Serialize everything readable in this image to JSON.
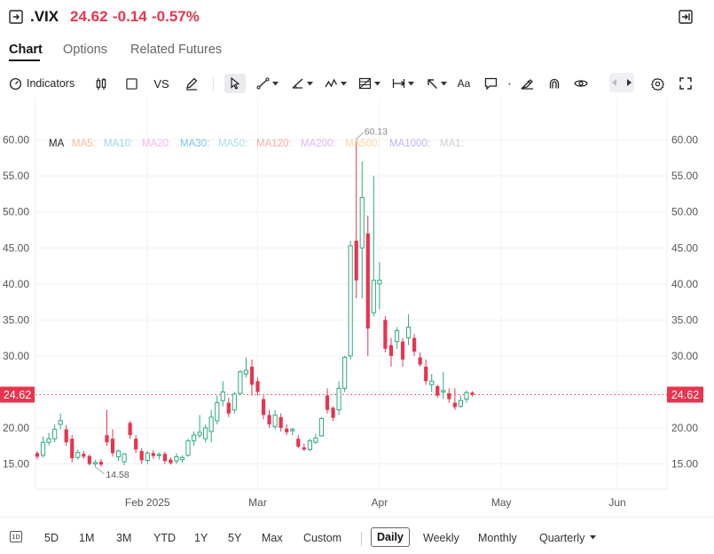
{
  "header": {
    "ticker": ".VIX",
    "price": "24.62",
    "change": "-0.14",
    "change_pct": "-0.57%"
  },
  "tabs": [
    {
      "label": "Chart",
      "active": true
    },
    {
      "label": "Options",
      "active": false
    },
    {
      "label": "Related Futures",
      "active": false
    }
  ],
  "toolbar": {
    "indicators_label": "Indicators",
    "vs_label": "VS",
    "text_label": "Aa"
  },
  "ma_legend": {
    "title": "MA",
    "items": [
      {
        "label": "MA5:",
        "color": "#f7b89a"
      },
      {
        "label": "MA10:",
        "color": "#9fd3ee"
      },
      {
        "label": "MA20:",
        "color": "#f3b6e8"
      },
      {
        "label": "MA30:",
        "color": "#7cc3e8"
      },
      {
        "label": "MA50:",
        "color": "#a7dcef"
      },
      {
        "label": "MA120:",
        "color": "#f6aaa3"
      },
      {
        "label": "MA200:",
        "color": "#e0b4f0"
      },
      {
        "label": "MA500:",
        "color": "#fbd6a0"
      },
      {
        "label": "MA1000:",
        "color": "#c6b0f4"
      },
      {
        "label": "MA1:",
        "color": "#cfcfcf"
      }
    ]
  },
  "colors": {
    "up": "#2eab7f",
    "down": "#e8344e",
    "grid": "#f0f0f0"
  },
  "chart_data": {
    "type": "candlestick",
    "y_ticks": [
      "60.00",
      "55.00",
      "50.00",
      "45.00",
      "40.00",
      "35.00",
      "30.00",
      "25.00",
      "20.00",
      "15.00"
    ],
    "x_ticks": [
      {
        "label": "Feb 2025",
        "index": 19
      },
      {
        "label": "Mar",
        "index": 38
      },
      {
        "label": "Apr",
        "index": 59
      },
      {
        "label": "May",
        "index": 80
      },
      {
        "label": "Jun",
        "index": 100
      }
    ],
    "ylim": [
      11.5,
      65.5
    ],
    "last_price": "24.62",
    "high_marker": "60.13",
    "low_marker": "14.58",
    "ohlc": [
      [
        16.5,
        16.8,
        15.6,
        16.0
      ],
      [
        16.2,
        18.8,
        15.9,
        18.0
      ],
      [
        18.0,
        19.3,
        17.6,
        18.5
      ],
      [
        18.5,
        20.5,
        18.0,
        19.8
      ],
      [
        20.5,
        22.0,
        19.8,
        21.0
      ],
      [
        19.8,
        20.4,
        17.5,
        18.0
      ],
      [
        18.5,
        19.0,
        15.2,
        15.8
      ],
      [
        15.9,
        17.0,
        15.6,
        16.6
      ],
      [
        16.4,
        16.8,
        15.7,
        16.0
      ],
      [
        16.1,
        16.3,
        14.8,
        15.0
      ],
      [
        15.0,
        15.6,
        14.6,
        15.2
      ],
      [
        15.3,
        15.7,
        14.6,
        14.9
      ],
      [
        19.0,
        22.5,
        17.5,
        18.0
      ],
      [
        18.5,
        19.8,
        16.0,
        16.5
      ],
      [
        16.0,
        17.0,
        15.4,
        16.8
      ],
      [
        15.3,
        16.5,
        14.8,
        16.4
      ],
      [
        20.7,
        21.0,
        18.5,
        19.0
      ],
      [
        18.5,
        19.0,
        16.5,
        17.0
      ],
      [
        16.8,
        17.2,
        15.0,
        15.5
      ],
      [
        15.5,
        16.8,
        15.0,
        16.5
      ],
      [
        16.5,
        16.9,
        15.7,
        16.1
      ],
      [
        16.2,
        16.6,
        15.6,
        16.3
      ],
      [
        16.4,
        16.7,
        15.0,
        15.4
      ],
      [
        15.6,
        15.9,
        14.9,
        15.1
      ],
      [
        15.4,
        16.5,
        15.0,
        16.0
      ],
      [
        15.6,
        16.2,
        15.2,
        15.9
      ],
      [
        16.2,
        18.5,
        16.0,
        18.2
      ],
      [
        18.2,
        19.5,
        17.5,
        19.0
      ],
      [
        19.0,
        21.8,
        18.6,
        19.4
      ],
      [
        18.5,
        20.5,
        18.0,
        20.0
      ],
      [
        19.5,
        22.5,
        18.0,
        21.5
      ],
      [
        21.0,
        24.5,
        20.5,
        23.5
      ],
      [
        23.8,
        26.5,
        23.0,
        25.0
      ],
      [
        23.5,
        24.2,
        21.5,
        22.0
      ],
      [
        22.5,
        25.0,
        22.0,
        24.7
      ],
      [
        24.8,
        28.0,
        24.5,
        27.8
      ],
      [
        27.5,
        29.8,
        27.0,
        28.0
      ],
      [
        28.5,
        29.5,
        24.5,
        26.0
      ],
      [
        26.5,
        27.0,
        24.5,
        25.0
      ],
      [
        24.0,
        24.5,
        21.2,
        21.8
      ],
      [
        21.8,
        22.5,
        20.0,
        20.5
      ],
      [
        20.2,
        22.5,
        19.8,
        21.8
      ],
      [
        21.5,
        22.0,
        19.5,
        20.0
      ],
      [
        19.9,
        20.5,
        19.0,
        19.4
      ],
      [
        19.6,
        20.0,
        19.0,
        19.8
      ],
      [
        18.5,
        19.0,
        17.2,
        17.4
      ],
      [
        17.3,
        17.8,
        16.8,
        17.0
      ],
      [
        17.0,
        18.5,
        16.8,
        18.2
      ],
      [
        18.0,
        19.2,
        17.8,
        18.6
      ],
      [
        18.9,
        21.5,
        18.8,
        21.3
      ],
      [
        24.5,
        25.5,
        22.0,
        22.5
      ],
      [
        22.8,
        23.0,
        21.0,
        21.4
      ],
      [
        22.5,
        26.5,
        21.8,
        25.5
      ],
      [
        25.5,
        30.0,
        25.0,
        29.8
      ],
      [
        30.0,
        46.0,
        29.5,
        45.3
      ],
      [
        46.0,
        60.13,
        38.0,
        40.5
      ],
      [
        45.0,
        57.0,
        38.0,
        52.0
      ],
      [
        47.0,
        49.5,
        30.0,
        33.8
      ],
      [
        36.0,
        55.0,
        35.5,
        40.5
      ],
      [
        40.0,
        43.0,
        36.5,
        40.5
      ],
      [
        35.0,
        35.5,
        30.5,
        31.0
      ],
      [
        31.5,
        32.5,
        28.5,
        30.0
      ],
      [
        32.0,
        34.0,
        31.0,
        33.5
      ],
      [
        32.0,
        32.5,
        28.5,
        29.5
      ],
      [
        32.5,
        35.8,
        31.5,
        34.0
      ],
      [
        32.5,
        33.0,
        30.0,
        30.6
      ],
      [
        29.8,
        30.5,
        28.5,
        28.8
      ],
      [
        28.5,
        29.5,
        26.0,
        26.5
      ],
      [
        26.0,
        27.5,
        25.0,
        26.5
      ],
      [
        25.8,
        26.0,
        24.2,
        24.5
      ],
      [
        25.0,
        27.8,
        24.0,
        25.2
      ],
      [
        24.8,
        25.5,
        23.5,
        24.0
      ],
      [
        23.5,
        25.5,
        22.5,
        22.9
      ],
      [
        23.0,
        24.5,
        22.8,
        23.8
      ],
      [
        24.0,
        25.2,
        23.5,
        24.9
      ],
      [
        24.9,
        25.1,
        24.4,
        24.62
      ]
    ]
  },
  "bottom": {
    "icon_label": "1D",
    "ranges": [
      "5D",
      "1M",
      "3M",
      "YTD",
      "1Y",
      "5Y",
      "Max",
      "Custom"
    ],
    "intervals": [
      "Daily",
      "Weekly",
      "Monthly",
      "Quarterly"
    ],
    "active_interval": "Daily"
  }
}
